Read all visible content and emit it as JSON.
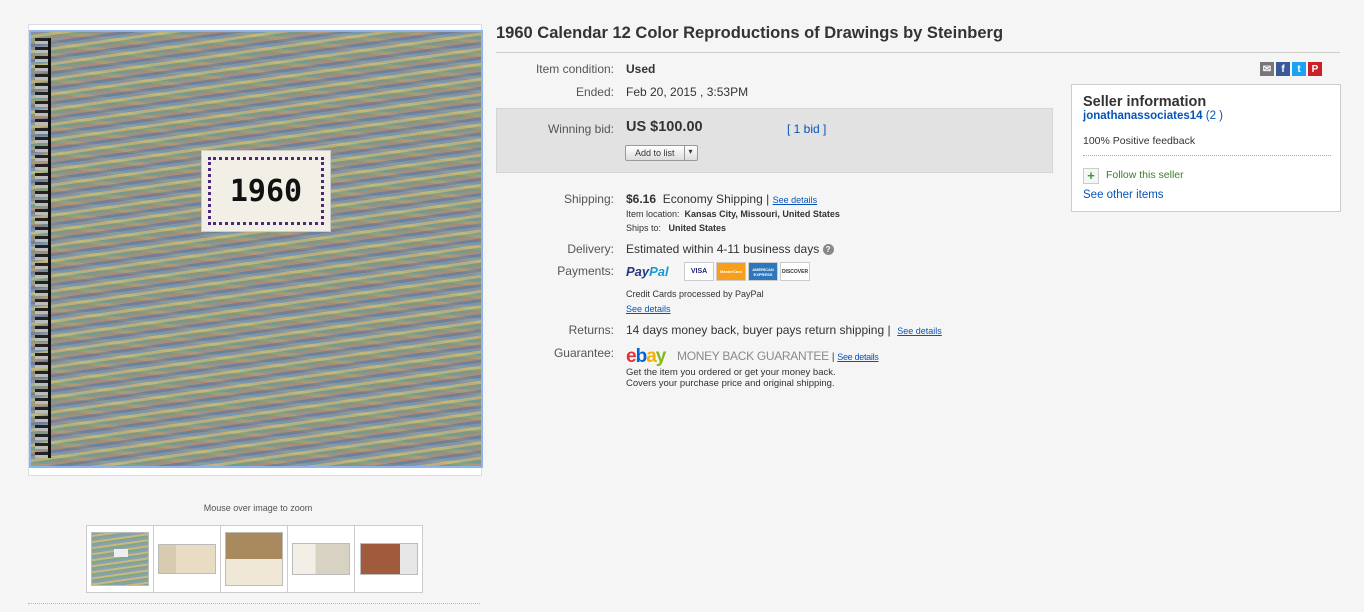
{
  "title": "1960 Calendar 12 Color Reproductions of Drawings by Steinberg",
  "image": {
    "cover_year": "1960",
    "zoom_hint": "Mouse over image to zoom",
    "thumbnail_count": 5
  },
  "details": {
    "condition_label": "Item condition:",
    "condition_value": "Used",
    "ended_label": "Ended:",
    "ended_value": "Feb 20, 2015 , 3:53PM",
    "winning_bid_label": "Winning bid:",
    "winning_bid_value": "US $100.00",
    "bids_link": "[ 1 bid ]",
    "add_to_list": "Add to list",
    "shipping_label": "Shipping:",
    "shipping_price": "$6.16",
    "shipping_method": "Economy Shipping",
    "see_details": "See details",
    "item_location_label": "Item location:",
    "item_location_value": "Kansas City, Missouri, United States",
    "ships_to_label": "Ships to:",
    "ships_to_value": "United States",
    "delivery_label": "Delivery:",
    "delivery_value": "Estimated within 4-11 business days",
    "payments_label": "Payments:",
    "paypal_a": "Pay",
    "paypal_b": "Pal",
    "cards": [
      "VISA",
      "MasterCard",
      "AMERICAN EXPRESS",
      "DISCOVER"
    ],
    "credit_note": "Credit Cards processed by PayPal",
    "payments_see_details": "See details",
    "returns_label": "Returns:",
    "returns_value": "14 days money back, buyer pays return shipping",
    "returns_see_details": "See details",
    "guarantee_label": "Guarantee:",
    "ebay_letters": [
      "e",
      "b",
      "a",
      "y"
    ],
    "ebay_colors": [
      "#e53238",
      "#0064d2",
      "#f5af02",
      "#86b817"
    ],
    "money_back": "MONEY BACK GUARANTEE",
    "guarantee_see_details": "See details",
    "guarantee_line1": "Get the item you ordered or get your money back.",
    "guarantee_line2": "Covers your purchase price and original shipping."
  },
  "seller": {
    "heading": "Seller information",
    "name": "jonathanassociates14",
    "score": "(2 )",
    "feedback": "100% Positive feedback",
    "follow": "Follow this seller",
    "other_items": "See other items"
  },
  "share_icons": [
    "email-icon",
    "facebook-icon",
    "twitter-icon",
    "pinterest-icon"
  ]
}
